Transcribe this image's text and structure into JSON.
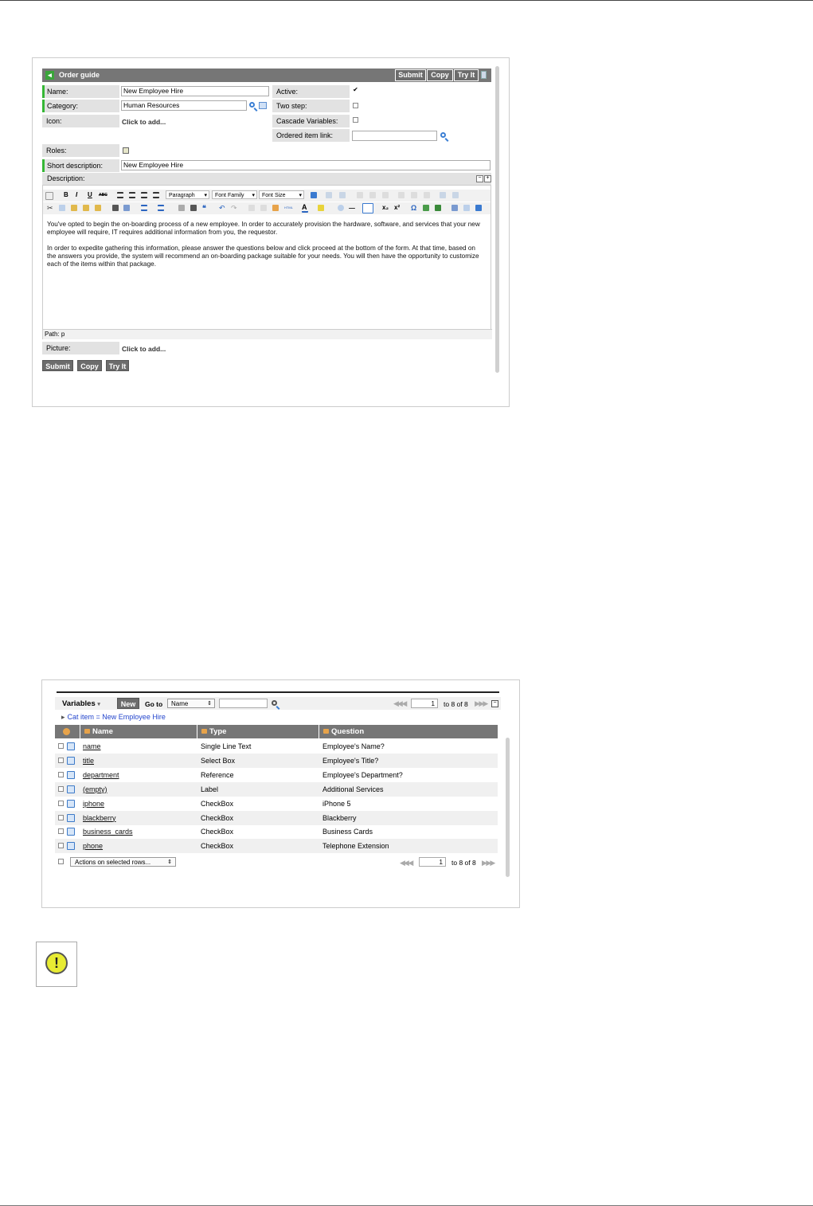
{
  "form": {
    "header_title": "Order guide",
    "buttons": {
      "submit": "Submit",
      "copy": "Copy",
      "try_it": "Try It"
    },
    "fields": {
      "name_label": "Name:",
      "name_value": "New Employee Hire",
      "category_label": "Category:",
      "category_value": "Human Resources",
      "icon_label": "Icon:",
      "icon_value": "Click to add...",
      "active_label": "Active:",
      "active_checked": true,
      "two_step_label": "Two step:",
      "cascade_label": "Cascade Variables:",
      "ordered_item_label": "Ordered item link:",
      "roles_label": "Roles:",
      "short_desc_label": "Short description:",
      "short_desc_value": "New Employee Hire",
      "description_label": "Description:",
      "picture_label": "Picture:",
      "picture_value": "Click to add..."
    },
    "editor": {
      "paragraph_select": "Paragraph",
      "font_family_select": "Font Family",
      "font_size_select": "Font Size",
      "paragraph1": "You've opted to begin the on-boarding process of a new employee. In order to accurately provision the hardware, software, and services that your new employee will require, IT requires additional information from you, the requestor.",
      "paragraph2": "In order to expedite gathering this information, please answer the questions below and click proceed at the bottom of the form. At that time, based on the answers you provide, the system will recommend an on-boarding package suitable for your needs. You will then have the opportunity to customize each of the items within that package.",
      "path": "Path: p"
    },
    "accent_color": "#35b735",
    "header_color": "#767676"
  },
  "variables": {
    "title": "Variables",
    "new_button": "New",
    "goto_label": "Go to",
    "goto_select": "Name",
    "page_value": "1",
    "page_of": "to 8 of 8",
    "filter": "Cat item = New Employee Hire",
    "columns": [
      "Name",
      "Type",
      "Question"
    ],
    "rows": [
      {
        "name": "name",
        "type": "Single Line Text",
        "question": "Employee's Name?"
      },
      {
        "name": "title",
        "type": "Select Box",
        "question": "Employee's Title?"
      },
      {
        "name": "department",
        "type": "Reference",
        "question": "Employee's Department?"
      },
      {
        "name": "(empty)",
        "type": "Label",
        "question": "Additional Services"
      },
      {
        "name": "iphone",
        "type": "CheckBox",
        "question": "iPhone 5"
      },
      {
        "name": "blackberry",
        "type": "CheckBox",
        "question": "Blackberry"
      },
      {
        "name": "business_cards",
        "type": "CheckBox",
        "question": "Business Cards"
      },
      {
        "name": "phone",
        "type": "CheckBox",
        "question": "Telephone Extension"
      }
    ],
    "actions_select": "Actions on selected rows..."
  },
  "warning": {
    "icon": "warning-exclamation-icon",
    "symbol": "!"
  }
}
